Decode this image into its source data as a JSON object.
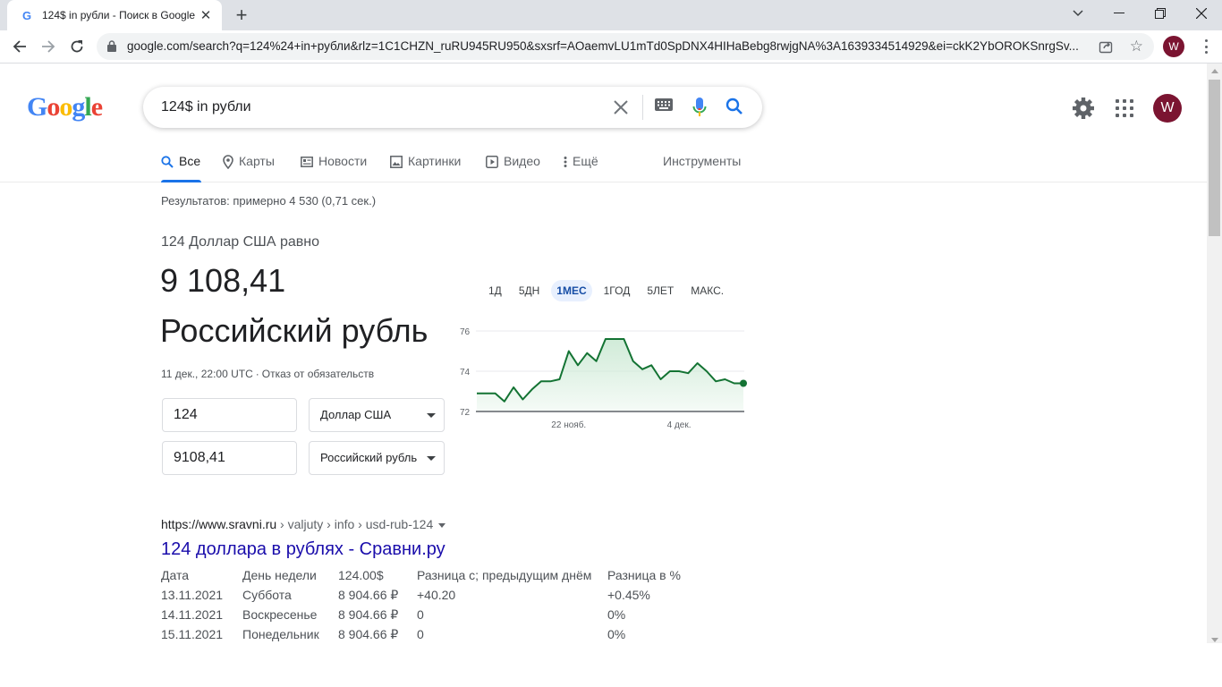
{
  "browser": {
    "tab_title": "124$ in рубли - Поиск в Google",
    "tab_favicon": "G",
    "url": "google.com/search?q=124%24+in+рубли&rlz=1C1CHZN_ruRU945RU950&sxsrf=AOaemvLU1mTd0SpDNX4HIHaBebg8rwjgNA%3A1639334514929&ei=ckK2YbOROKSnrgSv...",
    "profile_initial": "W"
  },
  "google": {
    "logo_text": "Google",
    "search_query": "124$ in рубли",
    "avatar_initial": "W",
    "tabs": [
      {
        "label": "Все",
        "icon": "search-icon"
      },
      {
        "label": "Карты",
        "icon": "map-pin-icon"
      },
      {
        "label": "Новости",
        "icon": "news-icon"
      },
      {
        "label": "Картинки",
        "icon": "image-icon"
      },
      {
        "label": "Видео",
        "icon": "video-icon"
      },
      {
        "label": "Ещё",
        "icon": "more-vert-icon"
      }
    ],
    "tools_label": "Инструменты",
    "result_stats": "Результатов: примерно 4 530 (0,71 сек.)"
  },
  "converter": {
    "equals_label": "124 Доллар США равно",
    "result_value": "9 108,41",
    "result_currency": "Российский рубль",
    "timestamp": "11 дек., 22:00 UTC",
    "separator": "·",
    "disclaimer": "Отказ от обязательств",
    "from_amount": "124",
    "from_currency": "Доллар США",
    "to_amount": "9108,41",
    "to_currency": "Российский рубль",
    "ranges": [
      "1Д",
      "5ДН",
      "1МЕС",
      "1ГОД",
      "5ЛЕТ",
      "МАКС."
    ],
    "selected_range": "1МЕС"
  },
  "chart_data": {
    "type": "area",
    "title": "",
    "xlabel": "",
    "ylabel": "",
    "ylim": [
      72,
      76
    ],
    "yticks": [
      "76",
      "74",
      "72"
    ],
    "xticks": [
      {
        "label": "22 нояб.",
        "index": 10
      },
      {
        "label": "4 дек.",
        "index": 22
      }
    ],
    "series": [
      {
        "values": [
          72.9,
          72.9,
          72.9,
          72.5,
          73.2,
          72.6,
          73.1,
          73.5,
          73.5,
          73.6,
          75.0,
          74.3,
          74.9,
          74.5,
          75.6,
          75.6,
          75.6,
          74.5,
          74.1,
          74.3,
          73.6,
          74.0,
          74.0,
          73.9,
          74.4,
          74.0,
          73.5,
          73.6,
          73.4,
          73.4
        ]
      }
    ],
    "line_color": "#137333",
    "fill_color": "#ceead6",
    "grid": true
  },
  "result": {
    "cite_domain": "https://www.sravni.ru",
    "cite_path": " › valjuty › info › usd-rub-124",
    "title": "124 доллара в рублях - Сравни.ру",
    "table": {
      "headers": [
        "Дата",
        "День недели",
        "124.00$",
        "Разница с; предыдущим днём",
        "Разница в %"
      ],
      "rows": [
        [
          "13.11.2021",
          "Суббота",
          "8 904.66 ₽",
          "+40.20",
          "+0.45%"
        ],
        [
          "14.11.2021",
          "Воскресенье",
          "8 904.66 ₽",
          "0",
          "0%"
        ],
        [
          "15.11.2021",
          "Понедельник",
          "8 904.66 ₽",
          "0",
          "0%"
        ]
      ]
    }
  }
}
